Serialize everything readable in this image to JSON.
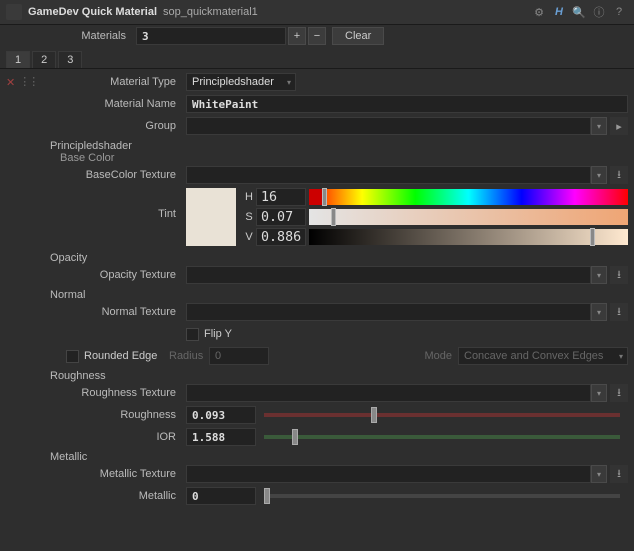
{
  "header": {
    "title": "GameDev Quick Material",
    "node": "sop_quickmaterial1",
    "icons": {
      "gear": "⚙",
      "h": "H",
      "search": "🔍",
      "info": "ⓘ",
      "help": "?"
    }
  },
  "materials": {
    "label": "Materials",
    "count": "3",
    "plus": "+",
    "minus": "−",
    "clear": "Clear"
  },
  "tabs": [
    "1",
    "2",
    "3"
  ],
  "matType": {
    "label": "Material Type",
    "value": "Principledshader"
  },
  "matName": {
    "label": "Material Name",
    "value": "WhitePaint"
  },
  "group": {
    "label": "Group",
    "value": ""
  },
  "baseColor": {
    "section": "Principledshader",
    "sub": "Base Color",
    "texLabel": "BaseColor Texture",
    "tintLabel": "Tint",
    "hLabel": "H",
    "hVal": "16",
    "sLabel": "S",
    "sVal": "0.07",
    "vLabel": "V",
    "vVal": "0.886"
  },
  "opacity": {
    "section": "Opacity",
    "texLabel": "Opacity Texture"
  },
  "normal": {
    "section": "Normal",
    "texLabel": "Normal Texture",
    "flipY": "Flip Y",
    "rounded": "Rounded Edge",
    "radiusLabel": "Radius",
    "radiusVal": "0",
    "modeLabel": "Mode",
    "modeVal": "Concave and Convex Edges"
  },
  "roughness": {
    "section": "Roughness",
    "texLabel": "Roughness Texture",
    "roughLabel": "Roughness",
    "roughVal": "0.093",
    "iorLabel": "IOR",
    "iorVal": "1.588"
  },
  "metallic": {
    "section": "Metallic",
    "texLabel": "Metallic Texture",
    "metLabel": "Metallic",
    "metVal": "0"
  },
  "icons": {
    "chev": "▾",
    "play": "▸",
    "picker": "⭳"
  }
}
